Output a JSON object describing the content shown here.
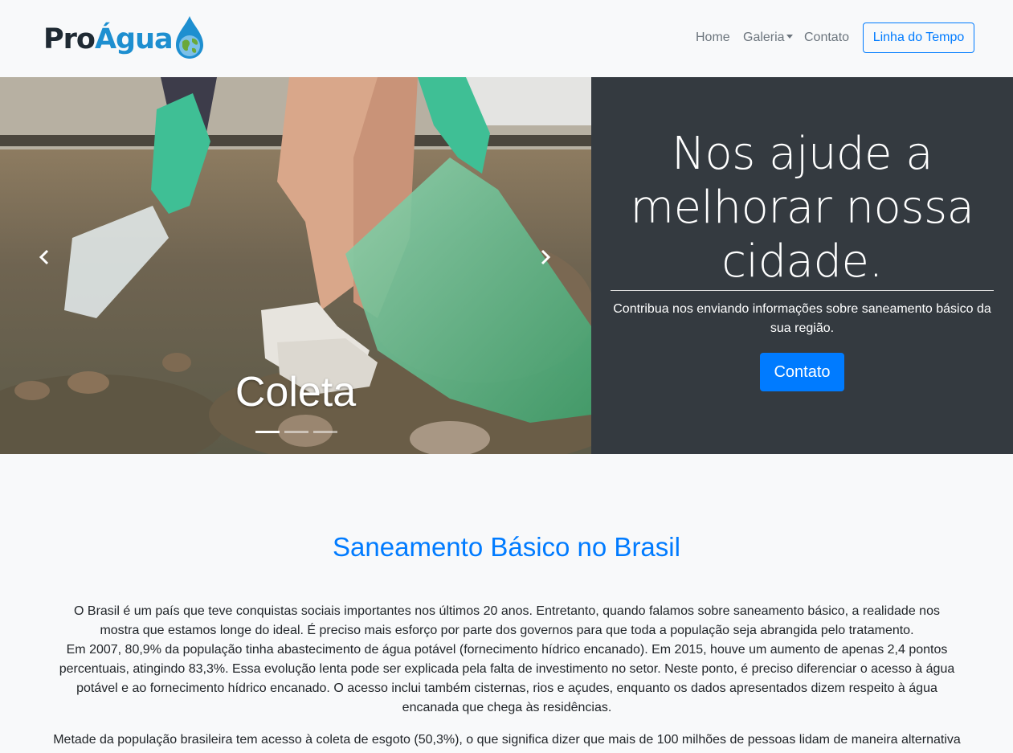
{
  "brand": {
    "part1": "Pro",
    "part2": "Água"
  },
  "nav": {
    "home": "Home",
    "galeria": "Galeria",
    "contato": "Contato",
    "timeline_button": "Linha do Tempo"
  },
  "carousel": {
    "caption": "Coleta",
    "slide_count": 3,
    "active_index": 0
  },
  "promo": {
    "title": "Nos ajude a melhorar nossa cidade.",
    "text": "Contribua nos enviando informações sobre saneamento básico da sua região.",
    "button": "Contato"
  },
  "article": {
    "title": "Saneamento Básico no Brasil",
    "paragraph1_line1": "O Brasil é um país que teve conquistas sociais importantes nos últimos 20 anos. Entretanto, quando falamos sobre saneamento básico, a realidade nos mostra que estamos longe do ideal. É preciso mais esforço por parte dos governos para que toda a população seja abrangida pelo tratamento.",
    "paragraph1_line2": "Em 2007, 80,9% da população tinha abastecimento de água potável (fornecimento hídrico encanado). Em 2015, houve um aumento de apenas 2,4 pontos percentuais, atingindo 83,3%. Essa evolução lenta pode ser explicada pela falta de investimento no setor. Neste ponto, é preciso diferenciar o acesso à água potável e ao fornecimento hídrico encanado. O acesso inclui também cisternas, rios e açudes, enquanto os dados apresentados dizem respeito à água encanada que chega às residências.",
    "paragraph2": "Metade da população brasileira tem acesso à coleta de esgoto (50,3%), o que significa dizer que mais de 100 milhões de pessoas lidam de maneira alternativa"
  },
  "colors": {
    "primary": "#007bff",
    "dark": "#343a40",
    "light": "#f8f9fa",
    "nav_text": "#6c757d"
  }
}
